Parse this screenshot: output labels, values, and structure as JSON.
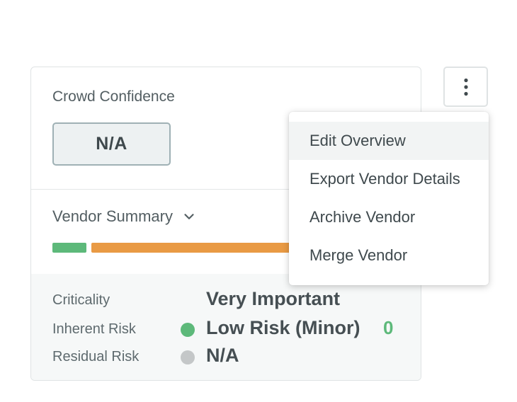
{
  "crowd_confidence": {
    "title": "Crowd Confidence",
    "value": "N/A"
  },
  "summary": {
    "title": "Vendor Summary",
    "bar": {
      "segments": [
        {
          "color": "#5db97a"
        },
        {
          "color": "#e99a44"
        }
      ]
    }
  },
  "risk": {
    "rows": [
      {
        "label": "Criticality",
        "value": "Very Important",
        "indicator_color": null,
        "count": null
      },
      {
        "label": "Inherent Risk",
        "value": "Low Risk (Minor)",
        "indicator_color": "#5db97a",
        "count": "0"
      },
      {
        "label": "Residual Risk",
        "value": "N/A",
        "indicator_color": "#c4c7c8",
        "count": null
      }
    ]
  },
  "menu": {
    "trigger_icon": "more-vertical-icon",
    "items": [
      {
        "label": "Edit Overview",
        "hovered": true
      },
      {
        "label": "Export Vendor Details",
        "hovered": false
      },
      {
        "label": "Archive Vendor",
        "hovered": false
      },
      {
        "label": "Merge Vendor",
        "hovered": false
      }
    ]
  }
}
